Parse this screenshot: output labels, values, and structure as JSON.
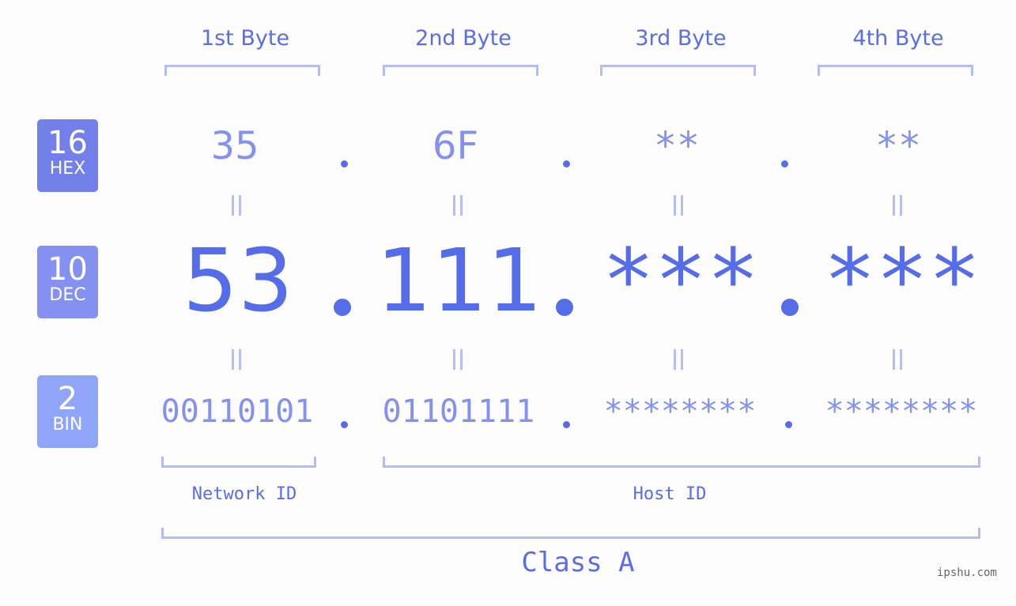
{
  "byte_headers": [
    "1st Byte",
    "2nd Byte",
    "3rd Byte",
    "4th Byte"
  ],
  "badges": [
    {
      "num": "16",
      "label": "HEX",
      "color": "#7380ea"
    },
    {
      "num": "10",
      "label": "DEC",
      "color": "#8491f0"
    },
    {
      "num": "2",
      "label": "BIN",
      "color": "#8fa6f8"
    }
  ],
  "hex": [
    "35",
    "6F",
    "**",
    "**"
  ],
  "dec": [
    "53",
    "111",
    "***",
    "***"
  ],
  "bin": [
    "00110101",
    "01101111",
    "********",
    "********"
  ],
  "network_id_label": "Network ID",
  "host_id_label": "Host ID",
  "class_label": "Class A",
  "watermark": "ipshu.com",
  "colors": {
    "primary": "#566de9",
    "light": "#8491ee",
    "bracket": "#b3bcf5"
  }
}
